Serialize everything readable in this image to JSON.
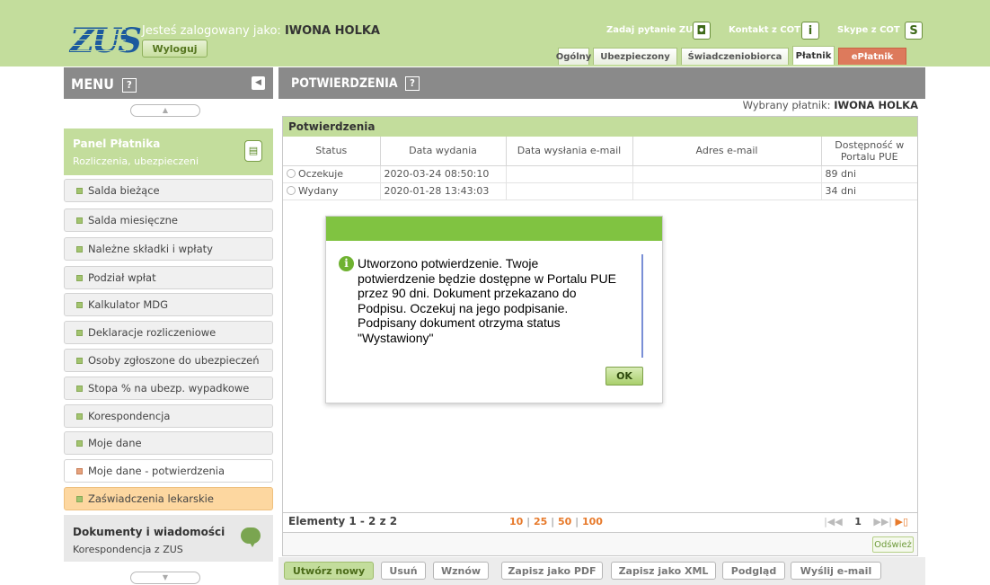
{
  "header": {
    "logo_text": "ZUS",
    "logged_in_label": "Jesteś zalogowany jako:",
    "user_name": "IWONA HOLKA",
    "logout_label": "Wyloguj",
    "links": [
      {
        "label": "Zadaj pytanie ZUS",
        "icon": "chat-icon"
      },
      {
        "label": "Kontakt z COT",
        "icon": "info-icon"
      },
      {
        "label": "Skype z COT",
        "icon": "skype-icon"
      }
    ],
    "tabs": [
      "Ogólny",
      "Ubezpieczony",
      "Świadczeniobiorca",
      "Płatnik",
      "ePłatnik"
    ],
    "active_tab": "Płatnik"
  },
  "menu": {
    "title": "MENU",
    "help": "?",
    "panel": {
      "title": "Panel Płatnika",
      "subtitle": "Rozliczenia, ubezpieczeni"
    },
    "items": [
      "Salda bieżące",
      "Salda miesięczne",
      "Należne składki i wpłaty",
      "Podział wpłat",
      "Kalkulator MDG",
      "Deklaracje rozliczeniowe",
      "Osoby zgłoszone do ubezpieczeń",
      "Stopa % na ubezp. wypadkowe",
      "Korespondencja",
      "Moje dane",
      "Moje dane - potwierdzenia",
      "Zaświadczenia lekarskie"
    ],
    "docs": {
      "title": "Dokumenty i wiadomości",
      "subtitle": "Korespondencja z ZUS"
    }
  },
  "main": {
    "title": "POTWIERDZENIA",
    "help": "?",
    "selected_payer_label": "Wybrany płatnik:",
    "selected_payer": "IWONA HOLKA",
    "grid_title": "Potwierdzenia",
    "columns": [
      "Status",
      "Data wydania",
      "Data wysłania e-mail",
      "Adres e-mail",
      "Dostępność w Portalu PUE"
    ],
    "rows": [
      {
        "status": "Oczekuje",
        "issued": "2020-03-24 08:50:10",
        "sent": "",
        "email": "",
        "availability": "89 dni"
      },
      {
        "status": "Wydany",
        "issued": "2020-01-28 13:43:03",
        "sent": "",
        "email": "",
        "availability": "34 dni"
      }
    ],
    "pager": {
      "count_text": "Elementy 1 - 2 z 2",
      "page_sizes": [
        "10",
        "25",
        "50",
        "100"
      ],
      "page": "1"
    },
    "refresh_label": "Odśwież",
    "actions": [
      "Utwórz nowy",
      "Usuń",
      "Wznów",
      "Zapisz jako PDF",
      "Zapisz jako XML",
      "Podgląd",
      "Wyślij e-mail"
    ]
  },
  "dialog": {
    "message": "Utworzono potwierdzenie. Twoje\npotwierdzenie będzie dostępne w Portalu PUE\nprzez 90 dni. Dokument przekazano do\nPodpisu. Oczekuj na jego podpisanie.\nPodpisany dokument otrzyma status\n\"Wystawiony\"",
    "ok_label": "OK"
  },
  "colors": {
    "header_green": "#c3dd9c",
    "dialog_bar": "#80c341",
    "gray_bar": "#8a8a8a",
    "eplatnik_tab": "#dd7a5c",
    "highlight_item": "#fdd7a0"
  }
}
